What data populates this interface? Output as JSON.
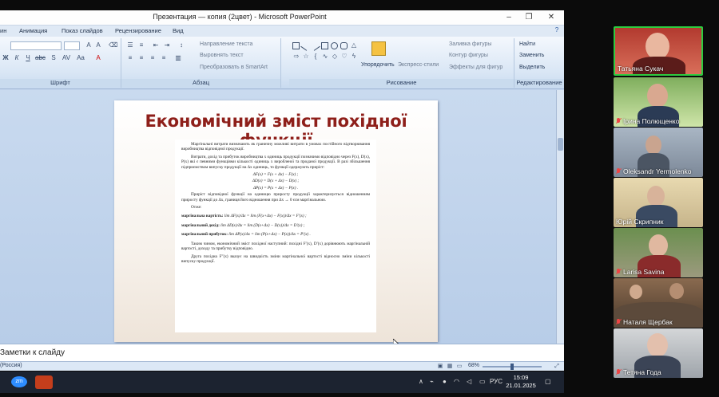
{
  "window": {
    "title": "Презентация — копия (2цвет) - Microsoft PowerPoint",
    "minimize_label": "–",
    "maximize_label": "❐",
    "close_label": "✕"
  },
  "ribbon": {
    "tabs": [
      "ин",
      "Анимация",
      "Показ слайдов",
      "Рецензирование",
      "Вид"
    ],
    "groups": {
      "font": "Шрифт",
      "paragraph": "Абзац",
      "drawing": "Рисование",
      "editing": "Редактирование"
    },
    "paragraph_items": [
      "Направление текста",
      "Выровнять текст",
      "Преобразовать в SmartArt"
    ],
    "arrange_label": "Упорядочить",
    "quick_styles_label": "Экспресс-стили",
    "shape_items": [
      "Заливка фигуры",
      "Контур фигуры",
      "Эффекты для фигур"
    ],
    "editing_items": [
      "Найти",
      "Заменить",
      "Выделить"
    ]
  },
  "slide": {
    "title": "Економічний зміст похідної функції",
    "paragraphs": [
      "Маргінальні витрати визначають як граничну можливі витрати в умовах постійного відтворювання виробництва відповідної продукції.",
      "Витрати, дохід та прибуток виробництва x одиниць продукції позначимо відповідно через F(x), D(x), P(x) які є певними функціями кількості одиниць x виробленої та проданої продукції. В разі збільшення підприємством випуску продукції на Δx одиниць, то функції одержують приріст:"
    ],
    "formulas": [
      "ΔF(x) = F(x + Δx) − F(x) ;",
      "ΔD(x) = D(x + Δx) − D(x) ;",
      "ΔP(x) = P(x + Δx) − P(x) ."
    ],
    "paragraph_3": "Приріст відповідної функції на одиницю приросту продукції характеризується відношенням приросту функції до Δx, границя його відношення при Δx → 0 єсм маргінальною.",
    "otzhe": "Отже:",
    "derivatives": [
      {
        "label": "маргінальна вартість:",
        "expr": "lim ΔF(x)/Δx = lim (F(x+Δx) − F(x))/Δx = F′(x) ;"
      },
      {
        "label": "маргінальний дохід:",
        "expr": "lim ΔD(x)/Δx = lim (D(x+Δx) − D(x))/Δx = D′(x) ;"
      },
      {
        "label": "маргінальний прибуток:",
        "expr": "lim ΔP(x)/Δx = lim (P(x+Δx) − P(x))/Δx = P′(x) ."
      }
    ],
    "conclusion": "Таким чином, економічний зміст похідної наступний: похідні F′(x), D′(x) дорівнюють маргінальній вартості, доходу та прибутку відповідно.",
    "last": "Друга похідна F″(x) вказує на швидкість зміни маргінальної вартості відносно зміни кількості випуску продукції."
  },
  "notes_placeholder": "Заметки к слайду",
  "status": {
    "language": "(Россия)",
    "zoom": "68%",
    "zoom_fraction": 0.5
  },
  "taskbar": {
    "time": "15:09",
    "date": "21.01.2025",
    "lang": "РУС",
    "zoom_app": "zm"
  },
  "participants": [
    {
      "name": "Татьяна Сукач",
      "muted": false
    },
    {
      "name": "Ірина Полющенко",
      "muted": true
    },
    {
      "name": "Oleksandr Yermolenko",
      "muted": true
    },
    {
      "name": "Юрій Скрипник",
      "muted": false
    },
    {
      "name": "Larisa Savina",
      "muted": true
    },
    {
      "name": "Наталя Щербак",
      "muted": true
    },
    {
      "name": "Тетяна Года",
      "muted": true
    }
  ],
  "colors": {
    "slide_title": "#8e1f1a",
    "active_speaker_border": "#2ecc40",
    "mute_red": "#ee4444"
  }
}
